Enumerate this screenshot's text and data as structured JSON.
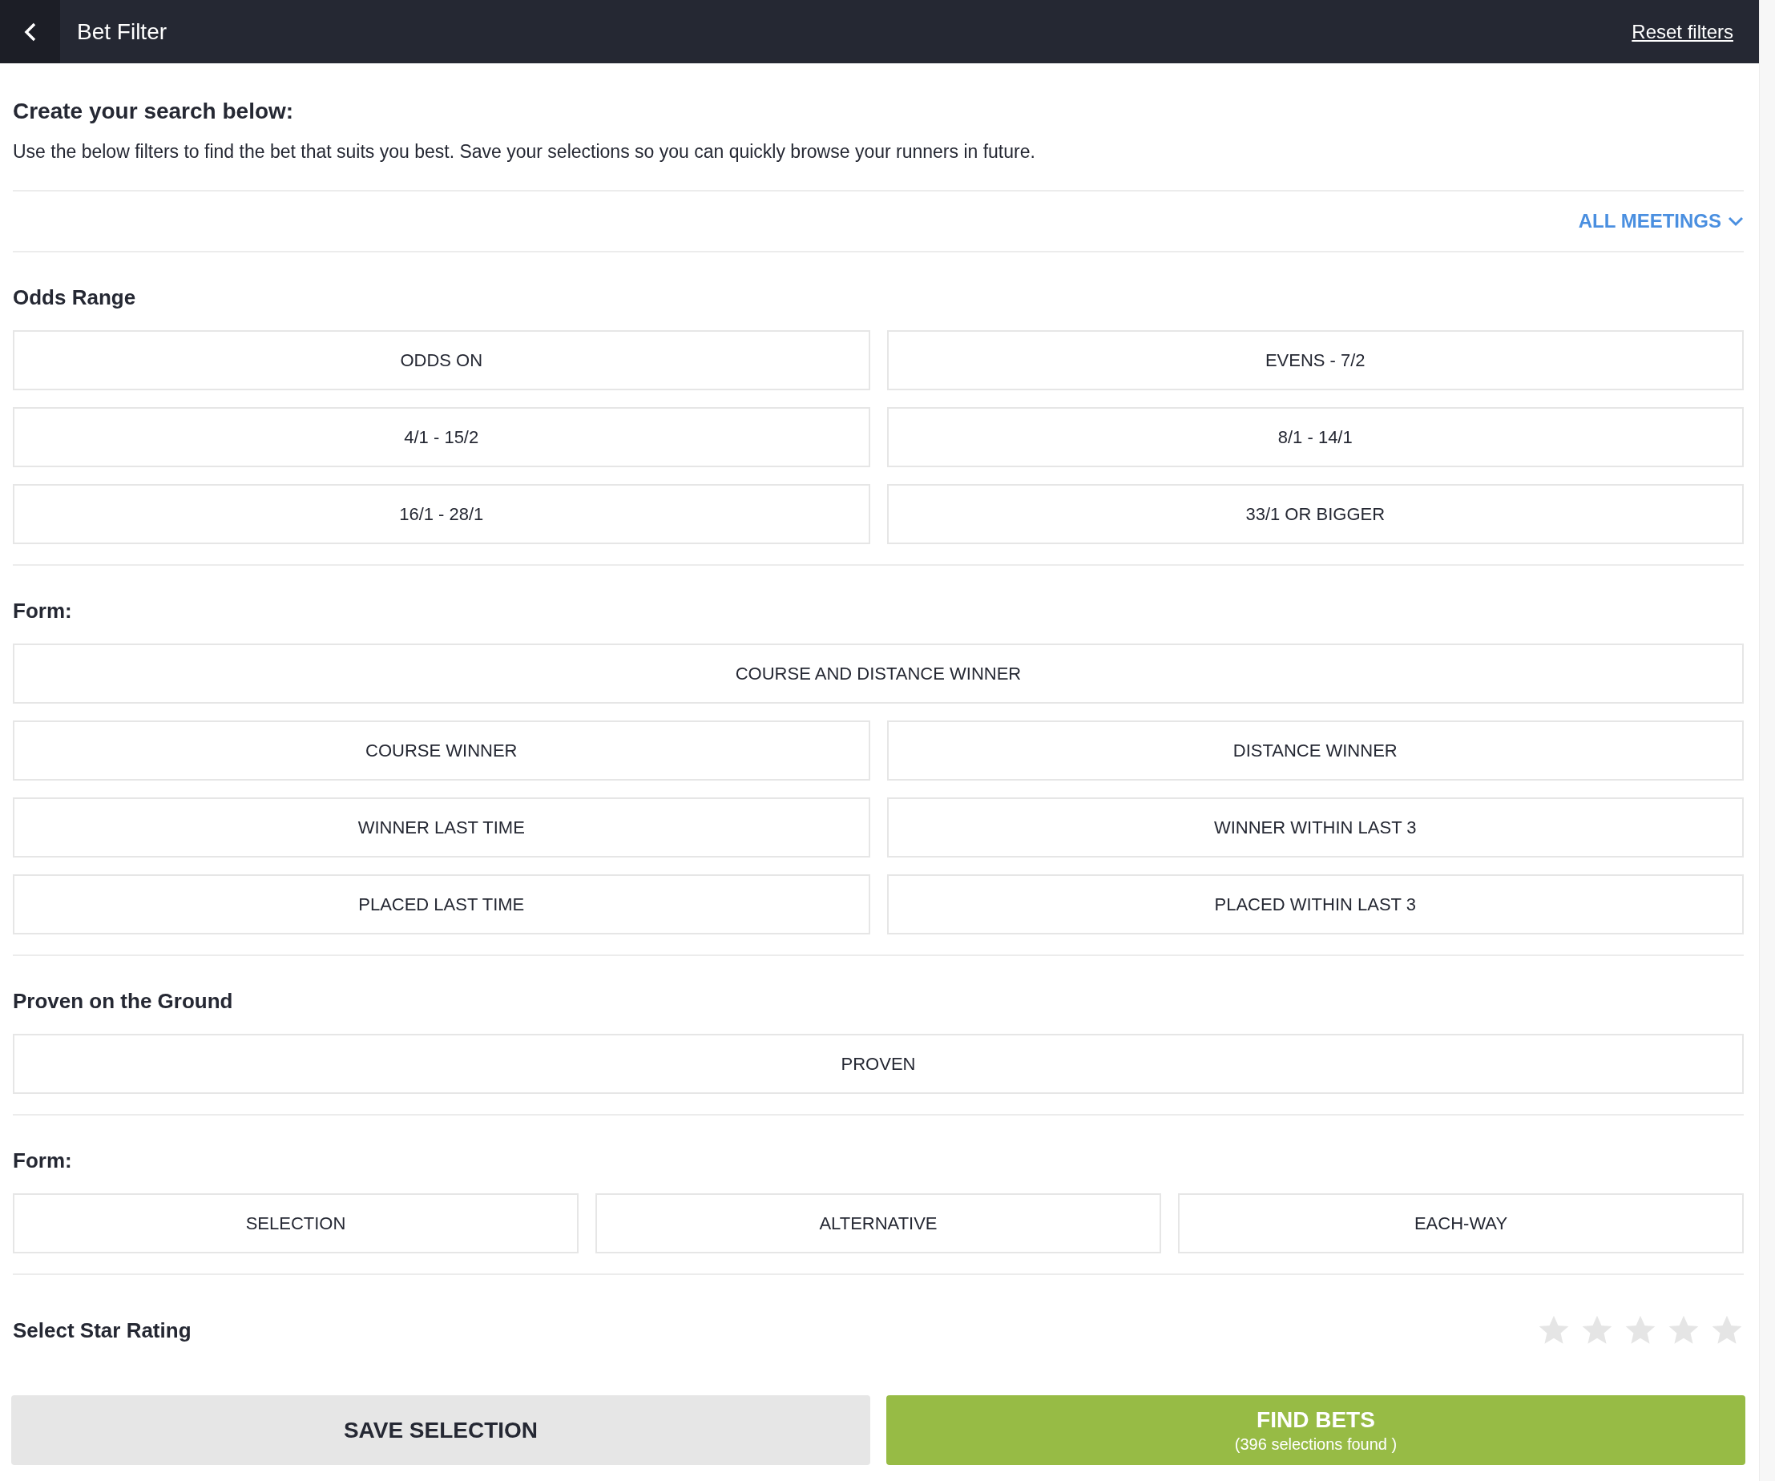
{
  "header": {
    "title": "Bet Filter",
    "reset_link": "Reset filters"
  },
  "intro": {
    "title": "Create your search below:",
    "text": "Use the below filters to find the bet that suits you best. Save your selections so you can quickly browse your runners in future."
  },
  "meetings_dropdown": {
    "label": "ALL MEETINGS"
  },
  "sections": [
    {
      "title": "Odds Range",
      "rows": [
        [
          {
            "label": "ODDS ON",
            "selected": false
          },
          {
            "label": "EVENS - 7/2",
            "selected": false
          }
        ],
        [
          {
            "label": "4/1 - 15/2",
            "selected": false
          },
          {
            "label": "8/1 - 14/1",
            "selected": false
          }
        ],
        [
          {
            "label": "16/1 - 28/1",
            "selected": false
          },
          {
            "label": "33/1 OR BIGGER",
            "selected": false
          }
        ]
      ]
    },
    {
      "title": "Form:",
      "rows": [
        [
          {
            "label": "COURSE AND DISTANCE WINNER",
            "selected": false
          }
        ],
        [
          {
            "label": "COURSE WINNER",
            "selected": false
          },
          {
            "label": "DISTANCE WINNER",
            "selected": false
          }
        ],
        [
          {
            "label": "WINNER LAST TIME",
            "selected": false
          },
          {
            "label": "WINNER WITHIN LAST 3",
            "selected": false
          }
        ],
        [
          {
            "label": "PLACED LAST TIME",
            "selected": false
          },
          {
            "label": "PLACED WITHIN LAST 3",
            "selected": false
          }
        ]
      ]
    },
    {
      "title": "Proven on the Ground",
      "rows": [
        [
          {
            "label": "PROVEN",
            "selected": false
          }
        ]
      ]
    },
    {
      "title": "Form:",
      "rows": [
        [
          {
            "label": "SELECTION",
            "selected": false
          },
          {
            "label": "ALTERNATIVE",
            "selected": false
          },
          {
            "label": "EACH-WAY",
            "selected": false
          }
        ]
      ]
    }
  ],
  "star_rating": {
    "label": "Select Star Rating",
    "stars": 0
  },
  "buttons": {
    "save": "SAVE SELECTION",
    "find": "FIND BETS",
    "find_count": "(396 selections found )"
  }
}
